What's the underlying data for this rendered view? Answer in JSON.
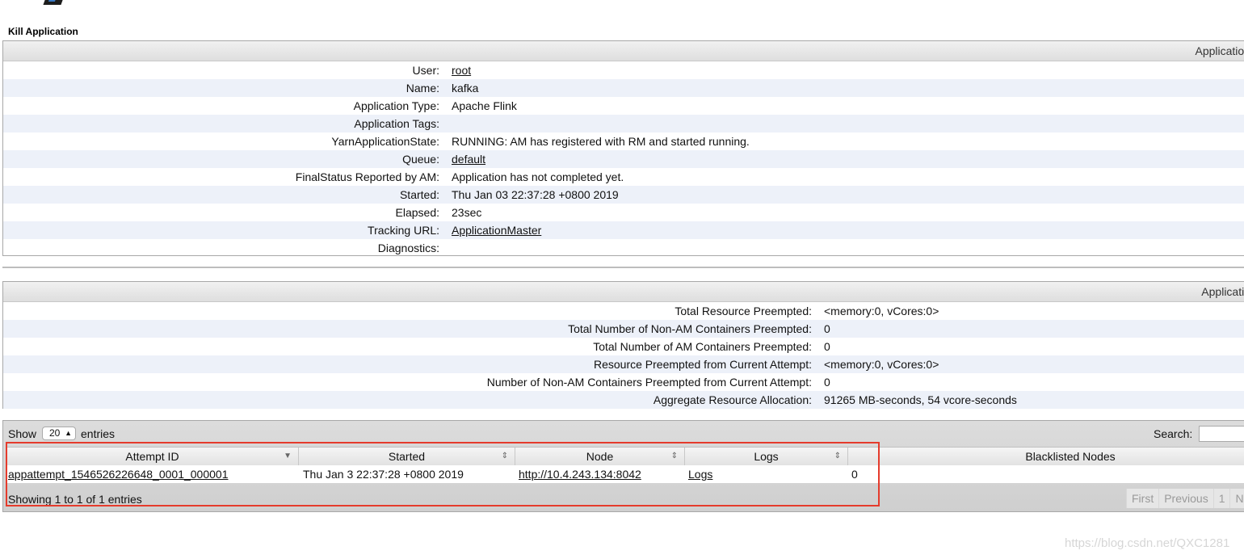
{
  "kill_label": "Kill Application",
  "overview": {
    "header": "Application",
    "rows": [
      {
        "key": "User:",
        "value": "root",
        "link": true
      },
      {
        "key": "Name:",
        "value": "kafka",
        "link": false
      },
      {
        "key": "Application Type:",
        "value": "Apache Flink",
        "link": false
      },
      {
        "key": "Application Tags:",
        "value": "",
        "link": false
      },
      {
        "key": "YarnApplicationState:",
        "value": "RUNNING: AM has registered with RM and started running.",
        "link": false
      },
      {
        "key": "Queue:",
        "value": "default",
        "link": true
      },
      {
        "key": "FinalStatus Reported by AM:",
        "value": "Application has not completed yet.",
        "link": false
      },
      {
        "key": "Started:",
        "value": "Thu Jan 03 22:37:28 +0800 2019",
        "link": false
      },
      {
        "key": "Elapsed:",
        "value": "23sec",
        "link": false
      },
      {
        "key": "Tracking URL:",
        "value": "ApplicationMaster",
        "link": true
      },
      {
        "key": "Diagnostics:",
        "value": "",
        "link": false
      }
    ]
  },
  "metrics": {
    "header": "Applicatio",
    "rows": [
      {
        "key": "Total Resource Preempted:",
        "value": "<memory:0, vCores:0>"
      },
      {
        "key": "Total Number of Non-AM Containers Preempted:",
        "value": "0"
      },
      {
        "key": "Total Number of AM Containers Preempted:",
        "value": "0"
      },
      {
        "key": "Resource Preempted from Current Attempt:",
        "value": "<memory:0, vCores:0>"
      },
      {
        "key": "Number of Non-AM Containers Preempted from Current Attempt:",
        "value": "0"
      },
      {
        "key": "Aggregate Resource Allocation:",
        "value": "91265 MB-seconds, 54 vcore-seconds"
      }
    ]
  },
  "attempts": {
    "show_label": "Show",
    "page_size": "20",
    "entries_label": "entries",
    "search_label": "Search:",
    "columns": [
      "Attempt ID",
      "Started",
      "Node",
      "Logs",
      "Blacklisted Nodes"
    ],
    "rows": [
      [
        "appattempt_1546526226648_0001_000001",
        "Thu Jan 3 22:37:28 +0800 2019",
        "http://10.4.243.134:8042",
        "Logs",
        "0"
      ]
    ],
    "info": "Showing 1 to 1 of 1 entries",
    "pager": [
      "First",
      "Previous",
      "1",
      "Ne"
    ]
  },
  "watermark": "https://blog.csdn.net/QXC1281",
  "colors": {
    "highlight_box": "#e53b2c",
    "row_stripe": "#edf1f9"
  }
}
